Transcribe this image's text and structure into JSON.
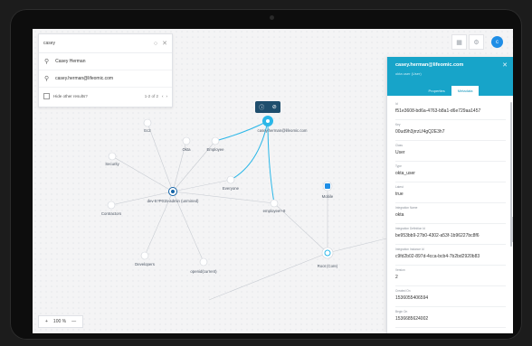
{
  "search": {
    "query": "casey",
    "results": [
      {
        "label": "Casey Herman"
      },
      {
        "label": "casey.herman@lifeomic.com"
      }
    ],
    "hide_label": "Hide other results?",
    "pager": "1-2 of 2"
  },
  "toolbar": {
    "avatar": "c"
  },
  "graph": {
    "nodes": [
      {
        "id": "casey",
        "label": "casey.herman@lifeomic.com"
      },
      {
        "id": "ec2",
        "label": "Ec2"
      },
      {
        "id": "security",
        "label": "Security"
      },
      {
        "id": "okta",
        "label": "Okta"
      },
      {
        "id": "employee",
        "label": "Employee"
      },
      {
        "id": "everyone",
        "label": "Everyone"
      },
      {
        "id": "center",
        "label": "dev-5?P015-admin (unmined)"
      },
      {
        "id": "contractors",
        "label": "Contractors"
      },
      {
        "id": "developers",
        "label": "Developers"
      },
      {
        "id": "openid",
        "label": "openid(current)"
      },
      {
        "id": "emp8",
        "label": "employee!+8"
      },
      {
        "id": "mobile",
        "label": "Mobile"
      },
      {
        "id": "root",
        "label": "Root (Core)"
      }
    ]
  },
  "context_menu": {
    "info_icon": "info-icon",
    "hide_icon": "eye-off-icon"
  },
  "detail": {
    "title": "casey.herman@lifeomic.com",
    "subtitle": "okta user (User)",
    "tabs": [
      "Properties",
      "Metadata"
    ],
    "active_tab": "Metadata",
    "fields": [
      {
        "label": "Id",
        "value": "f51e3608-bd6a-4763-b8a1-d6e729aa1457"
      },
      {
        "label": "Key",
        "value": "00ud9h3jrrzLf4gQ2E3h7"
      },
      {
        "label": "Class",
        "value": "User"
      },
      {
        "label": "Type",
        "value": "okta_user"
      },
      {
        "label": "Latest",
        "value": "true"
      },
      {
        "label": "Integration Name",
        "value": "okta"
      },
      {
        "label": "Integration Definition Id",
        "value": "be953bb9-27b0-4302-a53f-1b96227bc8f6"
      },
      {
        "label": "Integration Instance Id",
        "value": "c9fd2b02-897d-4cca-bcb4-7b2bd2920b83"
      },
      {
        "label": "Version",
        "value": "2"
      },
      {
        "label": "Created On",
        "value": "1536055406594"
      },
      {
        "label": "Begin On",
        "value": "1536685624002"
      }
    ]
  },
  "zoom": {
    "minus": "+",
    "level": "100 %",
    "plus": "—"
  },
  "colors": {
    "accent": "#17a4c9",
    "node": "#2bb7e8",
    "center": "#1565a8"
  }
}
